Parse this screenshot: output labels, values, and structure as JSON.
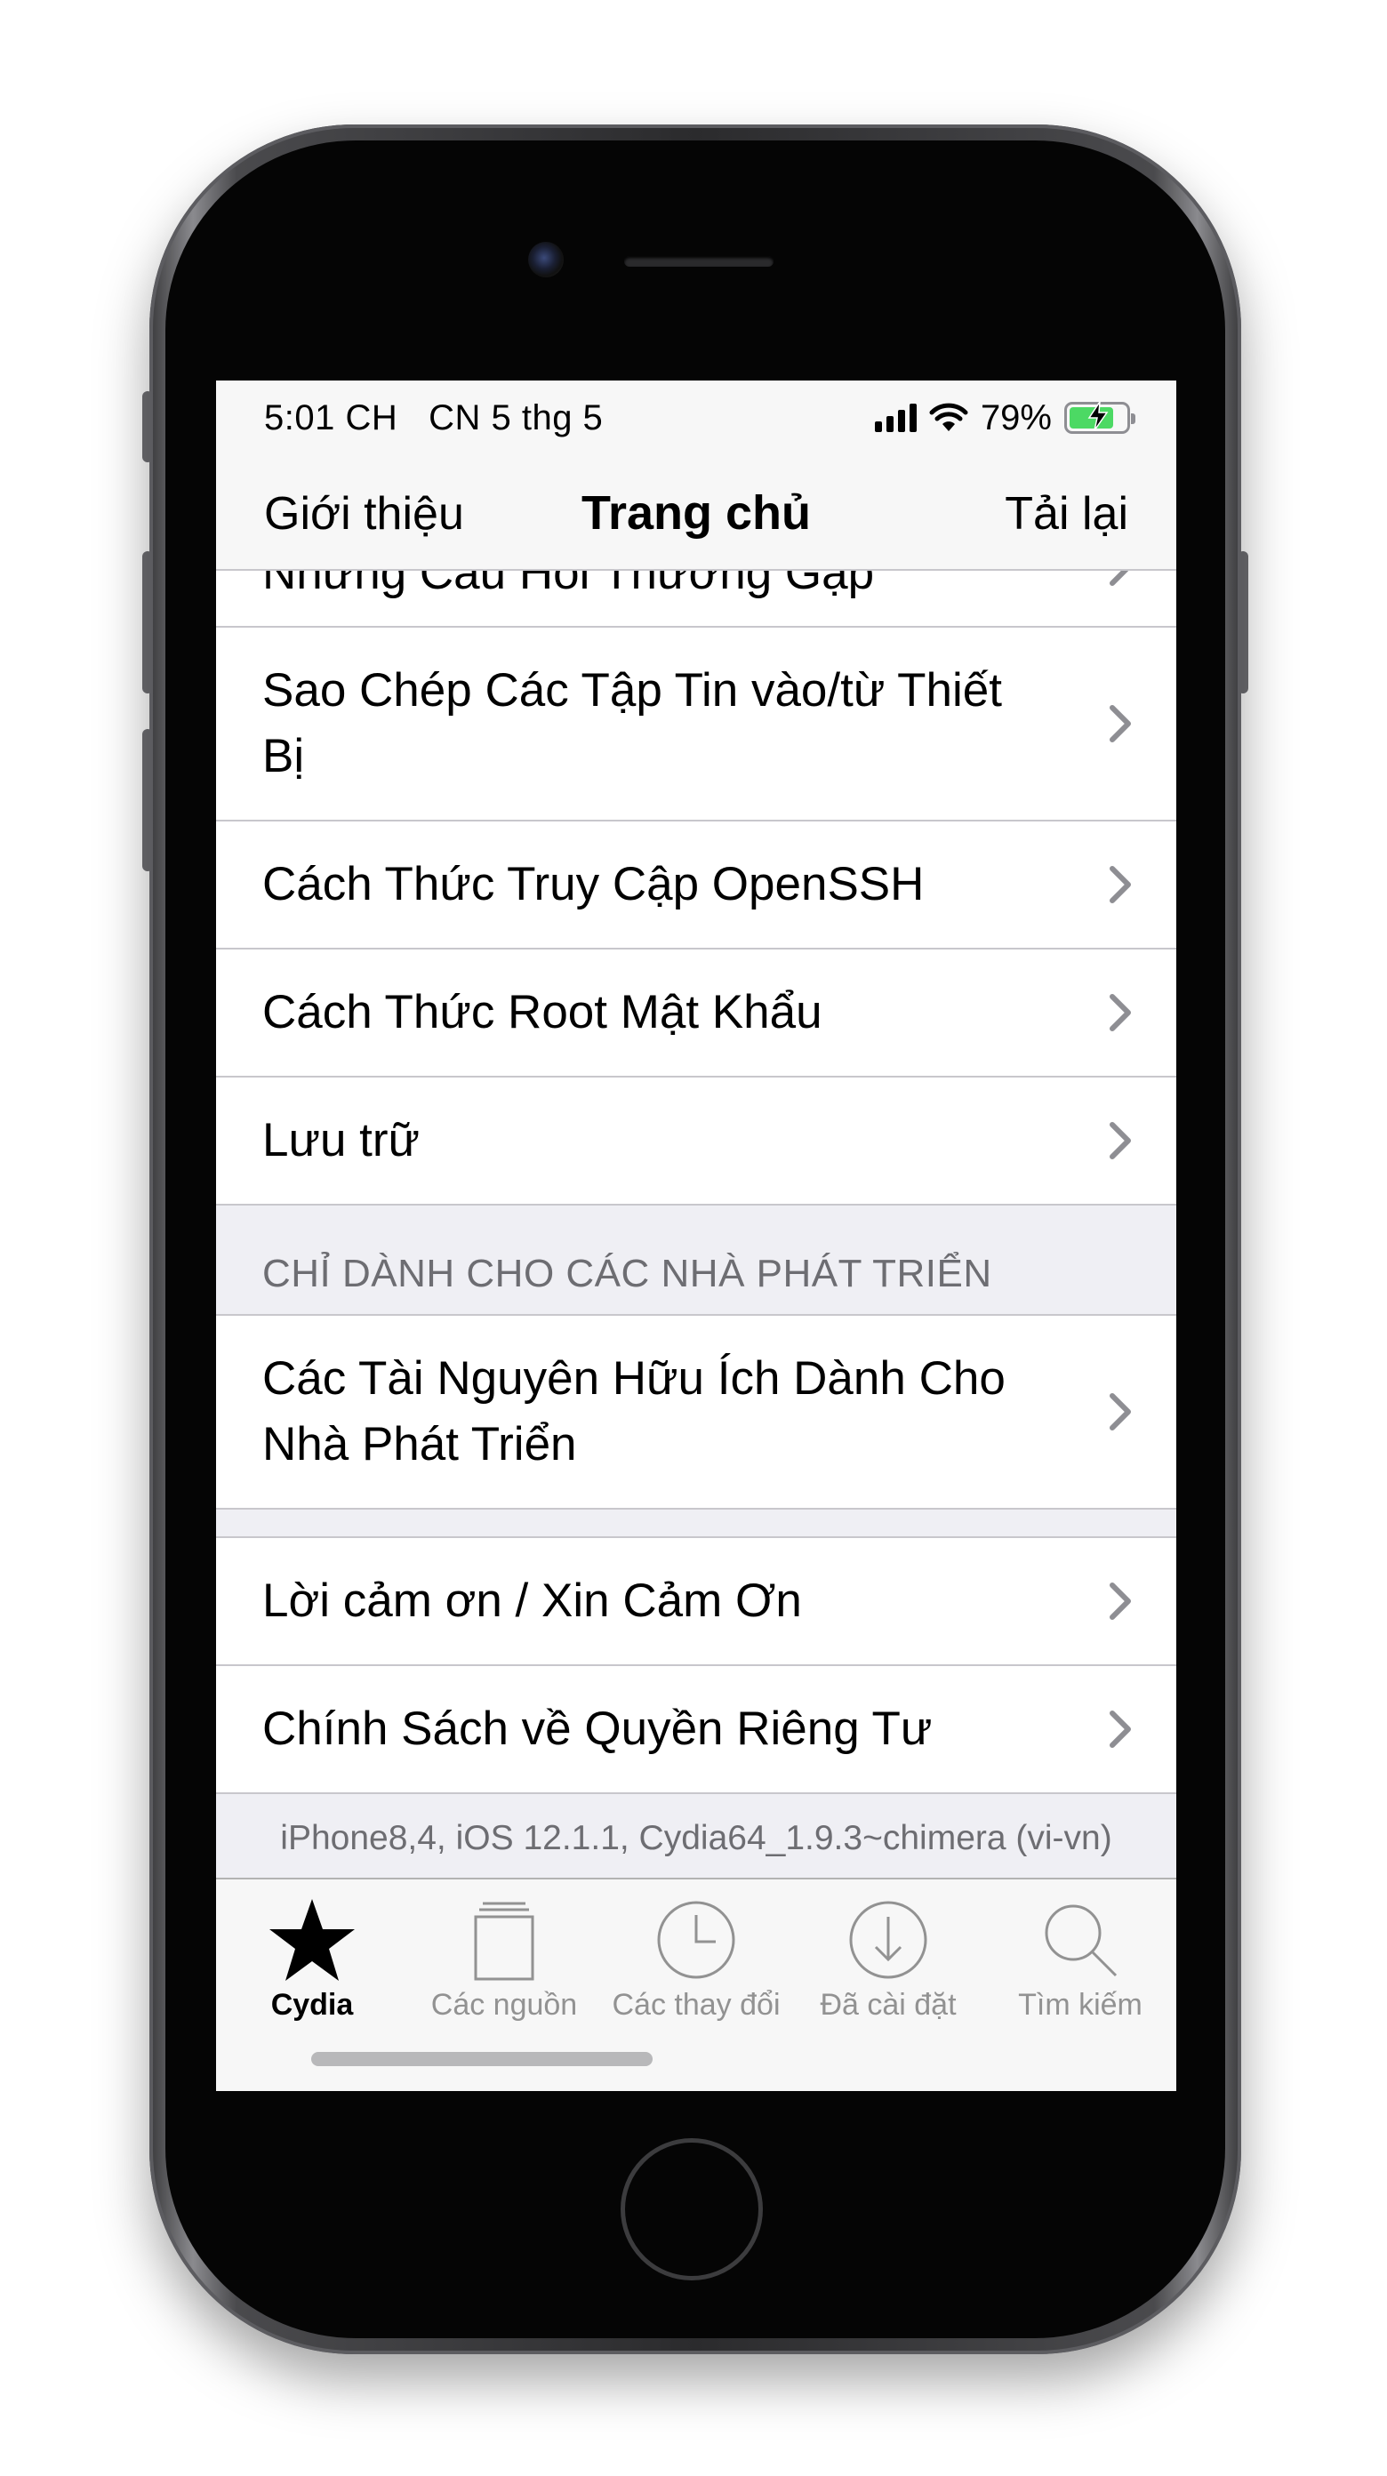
{
  "status_bar": {
    "time": "5:01 CH",
    "date": "CN 5 thg 5",
    "battery_percent": "79%",
    "battery_level": 0.79,
    "battery_color": "#4cd964"
  },
  "nav": {
    "left_label": "Giới thiệu",
    "title": "Trang chủ",
    "right_label": "Tải lại"
  },
  "list": {
    "partial_item": "Những Câu Hỏi Thường Gặp",
    "items_group_1": [
      "Sao Chép Các Tập Tin vào/từ Thiết Bị",
      "Cách Thức Truy Cập OpenSSH",
      "Cách Thức Root Mật Khẩu",
      "Lưu trữ"
    ],
    "developer_header": "CHỈ DÀNH CHO CÁC NHÀ PHÁT TRIỂN",
    "developer_item": "Các Tài Nguyên Hữu Ích Dành Cho Nhà Phát Triển",
    "items_group_3": [
      "Lời cảm ơn / Xin Cảm Ơn",
      "Chính Sách về Quyền Riêng Tư"
    ],
    "footer": "iPhone8,4, iOS 12.1.1, Cydia64_1.9.3~chimera (vi-vn)"
  },
  "tabs": [
    {
      "label": "Cydia",
      "icon": "star-icon",
      "active": true
    },
    {
      "label": "Các nguồn",
      "icon": "sources-icon",
      "active": false
    },
    {
      "label": "Các thay đổi",
      "icon": "clock-icon",
      "active": false
    },
    {
      "label": "Đã cài đặt",
      "icon": "download-icon",
      "active": false
    },
    {
      "label": "Tìm kiếm",
      "icon": "search-icon",
      "active": false
    }
  ]
}
